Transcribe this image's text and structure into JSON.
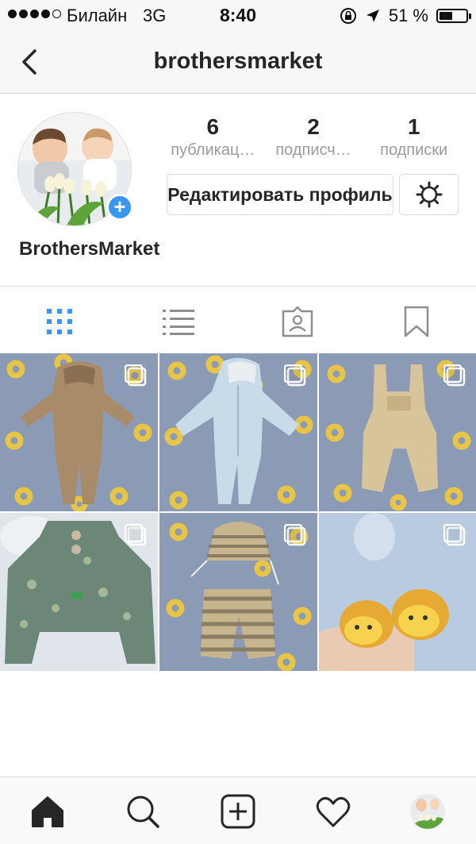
{
  "status_bar": {
    "carrier": "Билайн",
    "network": "3G",
    "time": "8:40",
    "battery_percent": "51 %",
    "battery_level": 0.51
  },
  "header": {
    "username": "brothersmarket",
    "back_icon": "chevron-left-icon"
  },
  "profile": {
    "full_name": "BrothersMarket",
    "stats": [
      {
        "count": "6",
        "label": "публикац…"
      },
      {
        "count": "2",
        "label": "подписч…"
      },
      {
        "count": "1",
        "label": "подписки"
      }
    ],
    "edit_button": "Редактировать профиль",
    "add_badge": "+"
  },
  "tabs": [
    {
      "icon": "grid-icon",
      "active": true
    },
    {
      "icon": "list-icon",
      "active": false
    },
    {
      "icon": "tagged-icon",
      "active": false
    },
    {
      "icon": "bookmark-icon",
      "active": false
    }
  ],
  "posts": [
    {
      "subject": "brown hooded romper",
      "multi": true
    },
    {
      "subject": "light blue hooded romper",
      "multi": true
    },
    {
      "subject": "beige dungarees",
      "multi": true
    },
    {
      "subject": "green printed jacket",
      "multi": true
    },
    {
      "subject": "striped hat and pants",
      "multi": true
    },
    {
      "subject": "yellow lion booties",
      "multi": true
    }
  ],
  "bottom_nav": [
    {
      "icon": "home-icon",
      "active": true
    },
    {
      "icon": "search-icon",
      "active": false
    },
    {
      "icon": "add-post-icon",
      "active": false
    },
    {
      "icon": "heart-icon",
      "active": false
    },
    {
      "icon": "profile-avatar",
      "active": false
    }
  ],
  "colors": {
    "accent": "#3897f0",
    "text": "#262626",
    "muted": "#9a9a9a",
    "border": "#dbdbdb",
    "inactive_icon": "#8e8e8e"
  }
}
